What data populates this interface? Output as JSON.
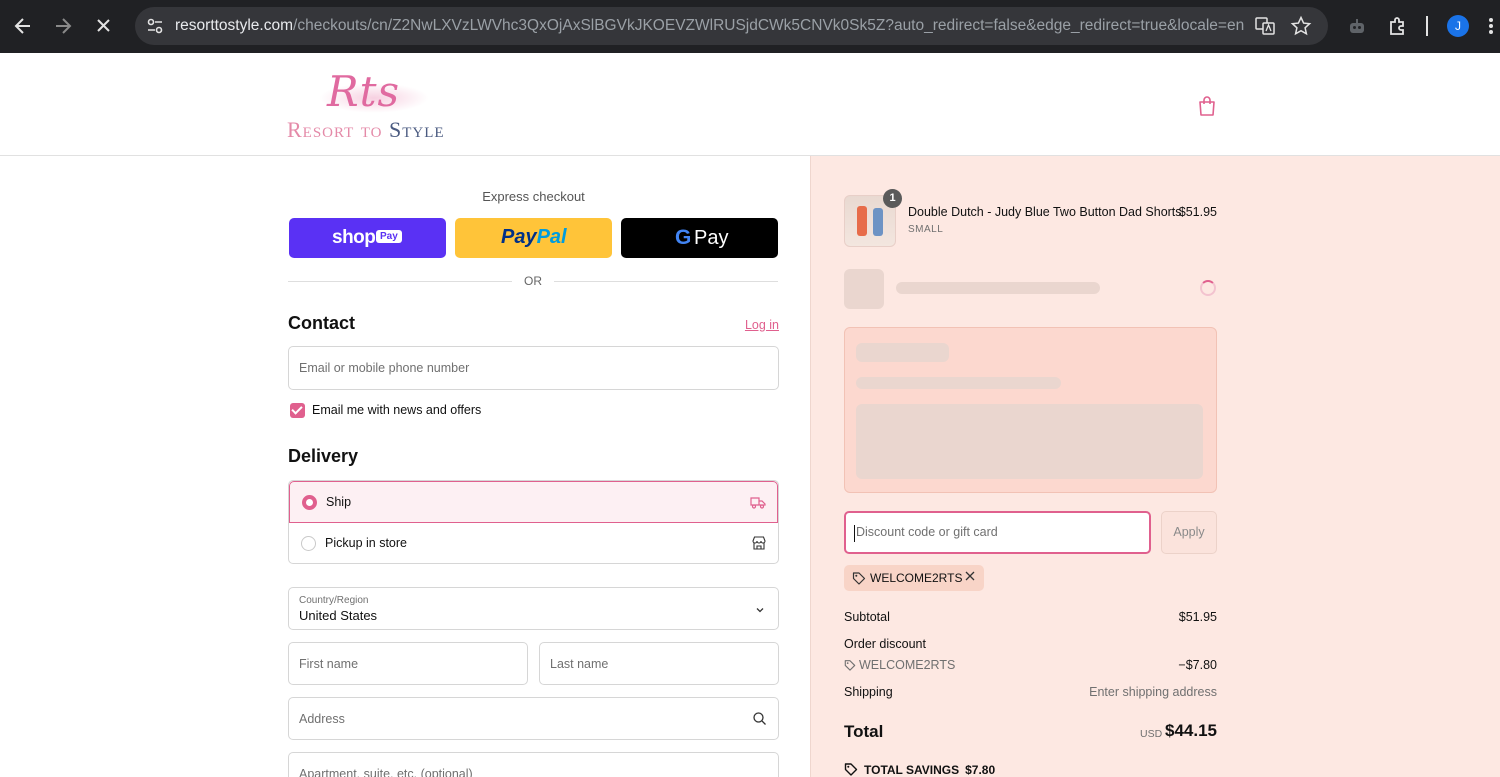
{
  "browser": {
    "url_host": "resorttostyle.com",
    "url_path": "/checkouts/cn/Z2NwLXVzLWVhc3QxOjAxSlBGVkJKOEVZWlRUSjdCWk5CNVk0Sk5Z?auto_redirect=false&edge_redirect=true&locale=en...",
    "avatar_letter": "J"
  },
  "header": {
    "logo_script": "Rts",
    "logo_word_resort": "Resort",
    "logo_word_to": "to",
    "logo_word_style": "Style",
    "icons": [
      "back-icon",
      "forward-icon",
      "close-icon",
      "tune-icon",
      "translate-icon",
      "star-icon",
      "extension-icon",
      "puzzle-icon",
      "more-icon",
      "shopping-bag-icon"
    ]
  },
  "express": {
    "label": "Express checkout",
    "shoppay": "shop",
    "shoppay_badge": "Pay",
    "paypal_a": "Pay",
    "paypal_b": "Pal",
    "gpay_g": "G",
    "gpay": "Pay",
    "or": "OR"
  },
  "contact": {
    "heading": "Contact",
    "login": "Log in",
    "email_placeholder": "Email or mobile phone number",
    "newsletter_label": "Email me with news and offers",
    "newsletter_checked": true
  },
  "delivery": {
    "heading": "Delivery",
    "options": [
      {
        "label": "Ship",
        "selected": true
      },
      {
        "label": "Pickup in store",
        "selected": false
      }
    ],
    "country_label": "Country/Region",
    "country_value": "United States",
    "first_name_placeholder": "First name",
    "last_name_placeholder": "Last name",
    "address_placeholder": "Address",
    "apartment_placeholder": "Apartment, suite, etc. (optional)"
  },
  "summary": {
    "item": {
      "quantity": "1",
      "name": "Double Dutch - Judy Blue Two Button Dad Shorts",
      "variant": "SMALL",
      "price": "$51.95"
    },
    "discount_placeholder": "Discount code or gift card",
    "apply": "Apply",
    "applied_code": "WELCOME2RTS",
    "subtotal_label": "Subtotal",
    "subtotal": "$51.95",
    "order_discount_label": "Order discount",
    "discount_code": "WELCOME2RTS",
    "discount_amount": "−$7.80",
    "shipping_label": "Shipping",
    "shipping_value": "Enter shipping address",
    "total_label": "Total",
    "currency": "USD",
    "total": "$44.15",
    "savings_label": "TOTAL SAVINGS",
    "savings_value": "$7.80"
  },
  "colors": {
    "accent": "#e0608e",
    "summary_bg": "#fde8e2",
    "shoppay": "#5a31f4",
    "paypal": "#ffc439",
    "gpay": "#000000"
  }
}
